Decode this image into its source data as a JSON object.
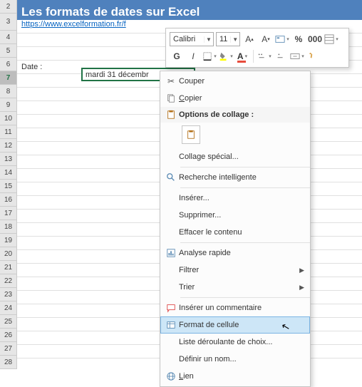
{
  "banner": {
    "title": "Les formats de dates sur Excel",
    "url": "https://www.excelformation.fr/f"
  },
  "rows": [
    "2",
    "3",
    "4",
    "5",
    "6",
    "7",
    "8",
    "9",
    "10",
    "11",
    "12",
    "13",
    "14",
    "15",
    "16",
    "17",
    "18",
    "19",
    "20",
    "21",
    "22",
    "23",
    "24",
    "25",
    "26",
    "27",
    "28"
  ],
  "selected_row": "7",
  "cellA7": "Date :",
  "cellB7": "mardi 31 décembr",
  "mini_toolbar": {
    "font": "Calibri",
    "size": "11",
    "buttons_row1": [
      "increase-font",
      "decrease-font",
      "format-builder",
      "percent",
      "thousands",
      "borders"
    ],
    "bold": "G",
    "italic": "I",
    "underline": "___"
  },
  "context_menu": {
    "cut": "Couper",
    "copy": "Copier",
    "paste_options": "Options de collage :",
    "paste_special": "Collage spécial...",
    "smart_lookup": "Recherche intelligente",
    "insert": "Insérer...",
    "delete": "Supprimer...",
    "clear": "Effacer le contenu",
    "quick_analysis": "Analyse rapide",
    "filter": "Filtrer",
    "sort": "Trier",
    "comment": "Insérer un commentaire",
    "format_cells": "Format de cellule",
    "dropdown_list": "Liste déroulante de choix...",
    "define_name": "Définir un nom...",
    "link": "Lien"
  }
}
